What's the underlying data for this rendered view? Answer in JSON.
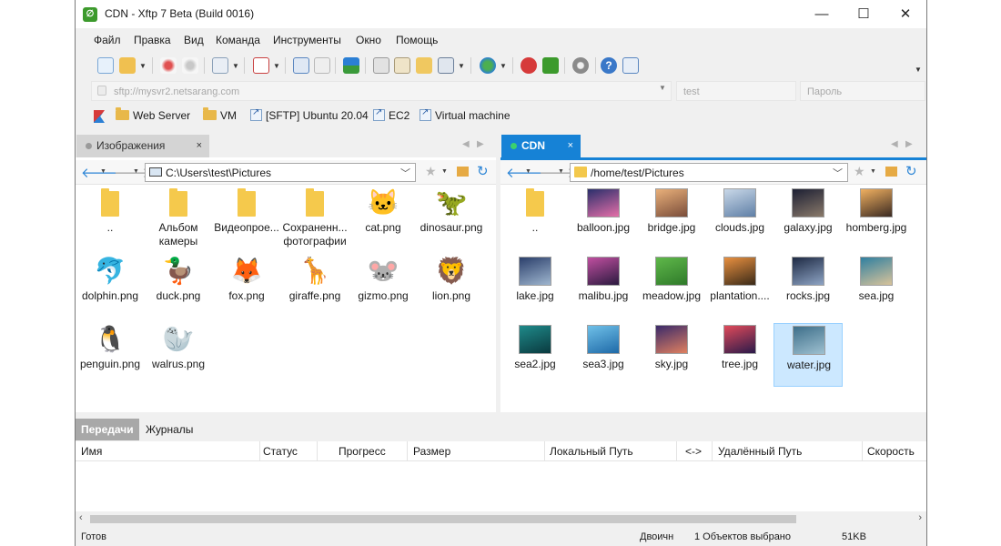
{
  "window": {
    "title": "CDN - Xftp 7 Beta (Build 0016)",
    "app_icon_glyph": "∅",
    "controls": {
      "minimize": "—",
      "maximize": "☐",
      "close": "✕"
    }
  },
  "menu": [
    "Файл",
    "Правка",
    "Вид",
    "Команда",
    "Инструменты",
    "Окно",
    "Помощь"
  ],
  "toolbar": {
    "icons": [
      "new-session-icon",
      "open-folder-icon",
      "disconnect-icon",
      "reconnect-icon",
      "session-properties-icon",
      "terminal-icon",
      "upload-icon",
      "download-icon",
      "transfer-icon",
      "copy-icon",
      "paste-icon",
      "move-icon",
      "view-mode-icon",
      "globe-icon",
      "xshell-icon",
      "xftp-icon",
      "settings-icon",
      "help-icon",
      "chat-icon"
    ]
  },
  "address": {
    "host_placeholder": "sftp://mysvr2.netsarang.com",
    "user_placeholder": "test",
    "password_placeholder": "Пароль"
  },
  "links": [
    "Web Server",
    "VM",
    "[SFTP] Ubuntu 20.04",
    "EC2",
    "Virtual machine"
  ],
  "left_pane": {
    "tab_label": "Изображения",
    "tab_close": "×",
    "path": "C:\\Users\\test\\Pictures",
    "items": [
      {
        "name": "..",
        "kind": "folder"
      },
      {
        "name": "Альбом камеры",
        "kind": "folder"
      },
      {
        "name": "Видеопрое...",
        "kind": "folder"
      },
      {
        "name": "Сохраненн... фотографии",
        "kind": "folder"
      },
      {
        "name": "cat.png",
        "kind": "animal",
        "glyph": "🐱"
      },
      {
        "name": "dinosaur.png",
        "kind": "animal",
        "glyph": "🦖"
      },
      {
        "name": "dolphin.png",
        "kind": "animal",
        "glyph": "🐬"
      },
      {
        "name": "duck.png",
        "kind": "animal",
        "glyph": "🦆"
      },
      {
        "name": "fox.png",
        "kind": "animal",
        "glyph": "🦊"
      },
      {
        "name": "giraffe.png",
        "kind": "animal",
        "glyph": "🦒"
      },
      {
        "name": "gizmo.png",
        "kind": "animal",
        "glyph": "🐭"
      },
      {
        "name": "lion.png",
        "kind": "animal",
        "glyph": "🦁"
      },
      {
        "name": "penguin.png",
        "kind": "animal",
        "glyph": "🐧"
      },
      {
        "name": "walrus.png",
        "kind": "animal",
        "glyph": "🦭"
      }
    ]
  },
  "right_pane": {
    "tab_label": "CDN",
    "tab_close": "×",
    "path": "/home/test/Pictures",
    "items": [
      {
        "name": "..",
        "kind": "folder"
      },
      {
        "name": "balloon.jpg",
        "kind": "photo",
        "colors": [
          "#2a2f6b",
          "#e46fa8"
        ]
      },
      {
        "name": "bridge.jpg",
        "kind": "photo",
        "colors": [
          "#e9b07a",
          "#7a4d3a"
        ]
      },
      {
        "name": "clouds.jpg",
        "kind": "photo",
        "colors": [
          "#c9d8e8",
          "#5f7fa6"
        ]
      },
      {
        "name": "galaxy.jpg",
        "kind": "photo",
        "colors": [
          "#1c1f33",
          "#8a7a6a"
        ]
      },
      {
        "name": "homberg.jpg",
        "kind": "photo",
        "colors": [
          "#f0b060",
          "#3a2a22"
        ]
      },
      {
        "name": "lake.jpg",
        "kind": "photo",
        "colors": [
          "#2b3f6b",
          "#9fb6cf"
        ]
      },
      {
        "name": "malibu.jpg",
        "kind": "photo",
        "colors": [
          "#c04fa0",
          "#2b1a3f"
        ]
      },
      {
        "name": "meadow.jpg",
        "kind": "photo",
        "colors": [
          "#5fb84a",
          "#2f7a2a"
        ]
      },
      {
        "name": "plantation....",
        "kind": "photo",
        "colors": [
          "#e89040",
          "#3a2a18"
        ]
      },
      {
        "name": "rocks.jpg",
        "kind": "photo",
        "colors": [
          "#1e2a44",
          "#8ea4c4"
        ]
      },
      {
        "name": "sea.jpg",
        "kind": "photo",
        "colors": [
          "#2f7fa0",
          "#d8c39a"
        ]
      },
      {
        "name": "sea2.jpg",
        "kind": "photo",
        "colors": [
          "#1f8a8a",
          "#0a3a3f"
        ]
      },
      {
        "name": "sea3.jpg",
        "kind": "photo",
        "colors": [
          "#6fc0e8",
          "#1f6aa8"
        ]
      },
      {
        "name": "sky.jpg",
        "kind": "photo",
        "colors": [
          "#3a2a6a",
          "#e08060"
        ]
      },
      {
        "name": "tree.jpg",
        "kind": "photo",
        "colors": [
          "#e04a5a",
          "#2a1a4a"
        ]
      },
      {
        "name": "water.jpg",
        "kind": "photo",
        "colors": [
          "#3e6f8a",
          "#9ec0d0"
        ],
        "selected": true
      }
    ]
  },
  "transfers": {
    "tabs": [
      "Передачи",
      "Журналы"
    ],
    "columns": [
      "Имя",
      "Статус",
      "Прогресс",
      "Размер",
      "Локальный Путь",
      "<->",
      "Удалённый Путь",
      "Скорость"
    ]
  },
  "status": {
    "left": "Готов",
    "mode": "Двоичн",
    "selection": "1 Объектов выбрано",
    "size": "51KB"
  },
  "colors": {
    "accent": "#1682d6",
    "folder": "#f5c94c",
    "selection": "#cce8ff"
  }
}
